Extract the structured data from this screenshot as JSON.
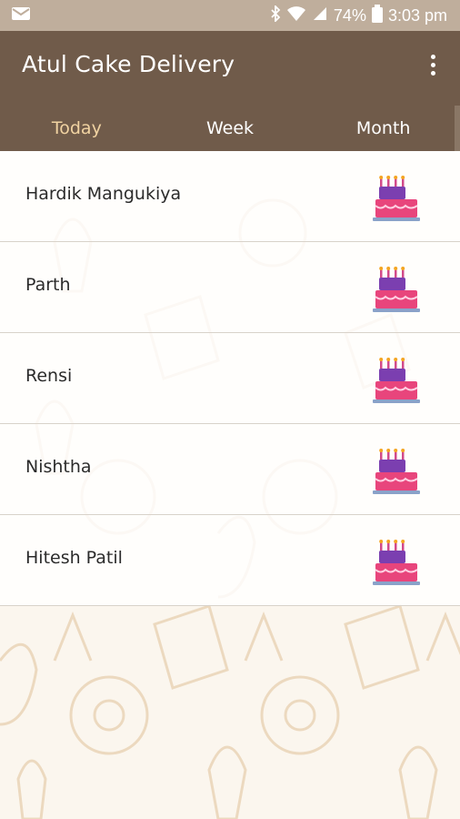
{
  "status_bar": {
    "battery_percent": "74%",
    "time": "3:03 pm",
    "icons": [
      "email-icon",
      "bluetooth-icon",
      "wifi-icon",
      "signal-icon",
      "battery-icon"
    ]
  },
  "app_bar": {
    "title": "Atul Cake Delivery",
    "menu_icon": "more-vertical-icon"
  },
  "tabs": [
    {
      "label": "Today",
      "active": true
    },
    {
      "label": "Week",
      "active": false
    },
    {
      "label": "Month",
      "active": false
    }
  ],
  "list": {
    "items": [
      {
        "name": "Hardik Mangukiya",
        "icon": "birthday-cake-icon"
      },
      {
        "name": "Parth",
        "icon": "birthday-cake-icon"
      },
      {
        "name": "Rensi",
        "icon": "birthday-cake-icon"
      },
      {
        "name": "Nishtha",
        "icon": "birthday-cake-icon"
      },
      {
        "name": "Hitesh Patil",
        "icon": "birthday-cake-icon"
      }
    ]
  },
  "colors": {
    "status_bar": "#bfae9c",
    "app_bar": "#705b4a",
    "active_tab": "#f1d3a2",
    "background": "#fbf6ee",
    "cake_top": "#7b3fb0",
    "cake_bottom": "#e8457c"
  }
}
